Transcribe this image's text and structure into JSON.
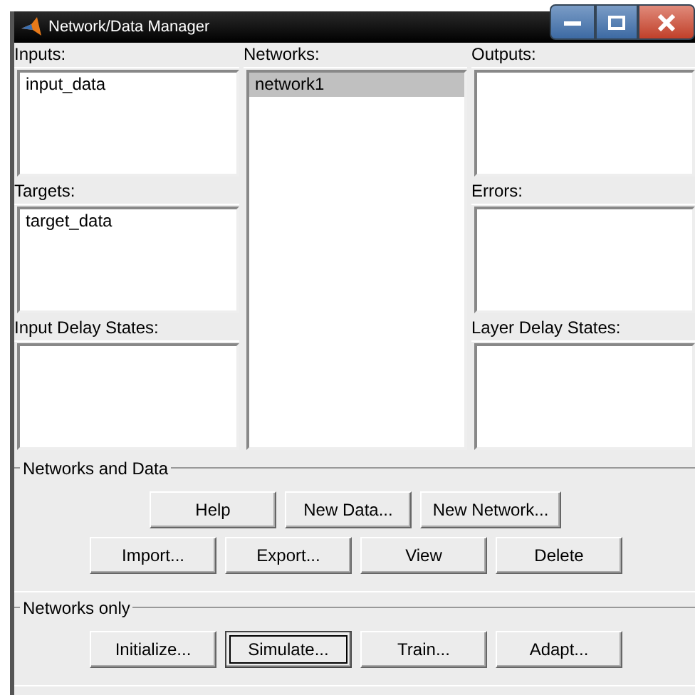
{
  "window": {
    "title": "Network/Data Manager",
    "controls": [
      {
        "kind": "minimize"
      },
      {
        "kind": "maximize"
      },
      {
        "kind": "close"
      }
    ]
  },
  "columns": [
    {
      "panes": [
        {
          "label": "Inputs:",
          "items": [
            {
              "text": "input_data",
              "selected": false
            }
          ]
        },
        {
          "label": "Targets:",
          "items": [
            {
              "text": "target_data",
              "selected": false
            }
          ]
        },
        {
          "label": "Input Delay States:"
        }
      ]
    },
    {
      "panes": [
        {
          "label": "Networks:",
          "items": [
            {
              "text": "network1",
              "selected": true
            }
          ]
        }
      ]
    },
    {
      "panes": [
        {
          "label": "Outputs:"
        },
        {
          "label": "Errors:"
        },
        {
          "label": "Layer Delay States:"
        }
      ]
    }
  ],
  "groups": [
    {
      "title": "Networks and Data",
      "rows": [
        [
          {
            "label": "Help",
            "focused": false
          },
          {
            "label": "New Data...",
            "focused": false
          },
          {
            "label": "New Network...",
            "focused": false
          }
        ],
        [
          {
            "label": "Import...",
            "focused": false
          },
          {
            "label": "Export...",
            "focused": false
          },
          {
            "label": "View",
            "focused": false
          },
          {
            "label": "Delete",
            "focused": false
          }
        ]
      ]
    },
    {
      "title": "Networks only",
      "rows": [
        [
          {
            "label": "Initialize...",
            "focused": false
          },
          {
            "label": "Simulate...",
            "focused": true
          },
          {
            "label": "Train...",
            "focused": false
          },
          {
            "label": "Adapt...",
            "focused": false
          }
        ]
      ]
    }
  ]
}
